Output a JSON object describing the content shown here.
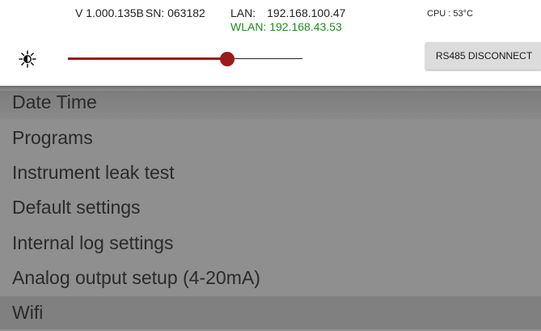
{
  "status": {
    "version": "V 1.000.135B",
    "serial": "SN: 063182",
    "lan_label": "LAN:",
    "lan_ip": "192.168.100.47",
    "wlan": "WLAN: 192.168.43.53",
    "cpu": "CPU : 53°C",
    "colors": {
      "wlan": "#1f8c1f"
    }
  },
  "controls": {
    "brightness_icon": "brightness-icon",
    "brightness_level": 0.68,
    "slider_color": "#9b1b1b",
    "rs485_button": "RS485 DISCONNECT"
  },
  "menu": {
    "items": [
      {
        "label": "Date Time"
      },
      {
        "label": "Programs"
      },
      {
        "label": "Instrument leak test"
      },
      {
        "label": "Default settings"
      },
      {
        "label": "Internal log settings"
      },
      {
        "label": "Analog output setup (4-20mA)"
      },
      {
        "label": "Wifi"
      }
    ]
  }
}
